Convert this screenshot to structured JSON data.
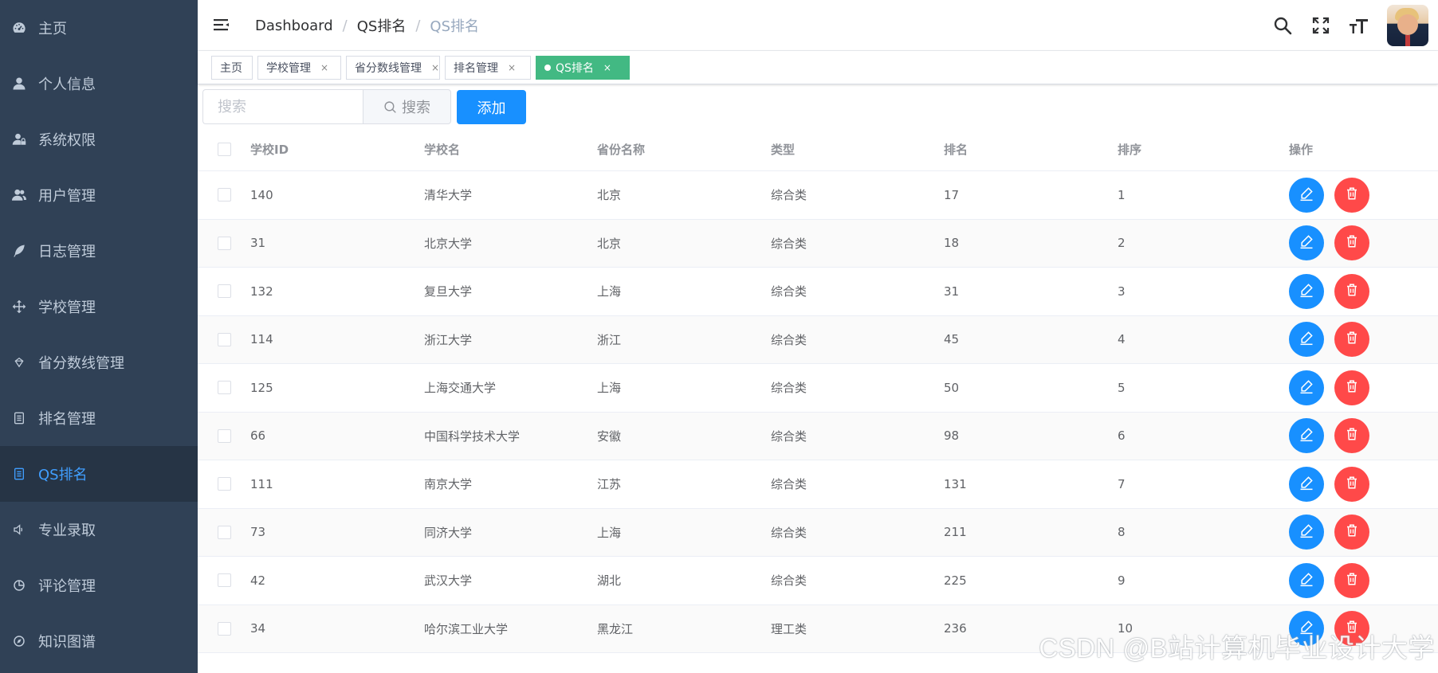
{
  "sidebar": {
    "items": [
      {
        "label": "主页",
        "icon": "dashboard-icon",
        "active": false
      },
      {
        "label": "个人信息",
        "icon": "user-icon",
        "active": false
      },
      {
        "label": "系统权限",
        "icon": "user-lock-icon",
        "active": false
      },
      {
        "label": "用户管理",
        "icon": "users-icon",
        "active": false
      },
      {
        "label": "日志管理",
        "icon": "feather-icon",
        "active": false
      },
      {
        "label": "学校管理",
        "icon": "move-icon",
        "active": false
      },
      {
        "label": "省分数线管理",
        "icon": "score-icon",
        "active": false
      },
      {
        "label": "排名管理",
        "icon": "document-icon",
        "active": false
      },
      {
        "label": "QS排名",
        "icon": "document-icon",
        "active": true
      },
      {
        "label": "专业录取",
        "icon": "speaker-icon",
        "active": false
      },
      {
        "label": "评论管理",
        "icon": "pie-chart-icon",
        "active": false
      },
      {
        "label": "知识图谱",
        "icon": "compass-icon",
        "active": false
      }
    ]
  },
  "navbar": {
    "breadcrumb": [
      "Dashboard",
      "QS排名",
      "QS排名"
    ],
    "separator": "/"
  },
  "tags": [
    {
      "label": "主页",
      "closable": false,
      "active": false
    },
    {
      "label": "学校管理",
      "closable": true,
      "active": false
    },
    {
      "label": "省分数线管理",
      "closable": true,
      "active": false
    },
    {
      "label": "排名管理",
      "closable": true,
      "active": false
    },
    {
      "label": "QS排名",
      "closable": true,
      "active": true
    }
  ],
  "tag_close_glyph": "×",
  "search": {
    "placeholder": "搜索",
    "button_label": "搜索"
  },
  "add_button_label": "添加",
  "table": {
    "columns": [
      "学校ID",
      "学校名",
      "省份名称",
      "类型",
      "排名",
      "排序",
      "操作"
    ],
    "rows": [
      [
        "140",
        "清华大学",
        "北京",
        "综合类",
        "17",
        "1"
      ],
      [
        "31",
        "北京大学",
        "北京",
        "综合类",
        "18",
        "2"
      ],
      [
        "132",
        "复旦大学",
        "上海",
        "综合类",
        "31",
        "3"
      ],
      [
        "114",
        "浙江大学",
        "浙江",
        "综合类",
        "45",
        "4"
      ],
      [
        "125",
        "上海交通大学",
        "上海",
        "综合类",
        "50",
        "5"
      ],
      [
        "66",
        "中国科学技术大学",
        "安徽",
        "综合类",
        "98",
        "6"
      ],
      [
        "111",
        "南京大学",
        "江苏",
        "综合类",
        "131",
        "7"
      ],
      [
        "73",
        "同济大学",
        "上海",
        "综合类",
        "211",
        "8"
      ],
      [
        "42",
        "武汉大学",
        "湖北",
        "综合类",
        "225",
        "9"
      ],
      [
        "34",
        "哈尔滨工业大学",
        "黑龙江",
        "理工类",
        "236",
        "10"
      ]
    ]
  },
  "watermark": "CSDN @B站计算机毕业设计大学",
  "colors": {
    "sidebar_bg": "#304156",
    "sidebar_active_bg": "#263445",
    "sidebar_text": "#bfcbd9",
    "active_text": "#409eff",
    "primary": "#1890ff",
    "danger": "#ff4949",
    "tag_active": "#42b983"
  }
}
